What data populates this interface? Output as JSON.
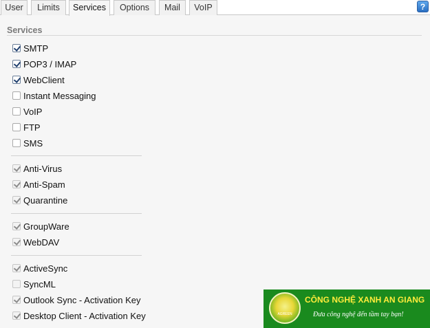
{
  "tabs": [
    "User",
    "Limits",
    "Services",
    "Options",
    "Mail",
    "VoIP"
  ],
  "active_tab": "Services",
  "help_label": "?",
  "section": {
    "title": "Services"
  },
  "groups": [
    {
      "items": [
        {
          "label": "SMTP",
          "checked": true
        },
        {
          "label": "POP3 / IMAP",
          "checked": true
        },
        {
          "label": "WebClient",
          "checked": true
        },
        {
          "label": "Instant Messaging",
          "checked": false
        },
        {
          "label": "VoIP",
          "checked": false
        },
        {
          "label": "FTP",
          "checked": false
        },
        {
          "label": "SMS",
          "checked": false
        }
      ]
    },
    {
      "items": [
        {
          "label": "Anti-Virus",
          "checked": true,
          "disabled": true
        },
        {
          "label": "Anti-Spam",
          "checked": true,
          "disabled": true
        },
        {
          "label": "Quarantine",
          "checked": true,
          "disabled": true
        }
      ]
    },
    {
      "items": [
        {
          "label": "GroupWare",
          "checked": true,
          "disabled": true
        },
        {
          "label": "WebDAV",
          "checked": true,
          "disabled": true
        }
      ]
    },
    {
      "items": [
        {
          "label": "ActiveSync",
          "checked": true,
          "disabled": true
        },
        {
          "label": "SyncML",
          "checked": false,
          "disabled": true
        },
        {
          "label": "Outlook Sync - Activation Key",
          "checked": true,
          "disabled": true
        },
        {
          "label": "Desktop Client - Activation Key",
          "checked": true,
          "disabled": true
        }
      ]
    }
  ],
  "watermark": {
    "title": "CÔNG NGHỆ XANH AN GIANG",
    "subtitle": "Đưa công nghệ đến tầm tay bạn!",
    "logo_text": "AGREEN"
  }
}
